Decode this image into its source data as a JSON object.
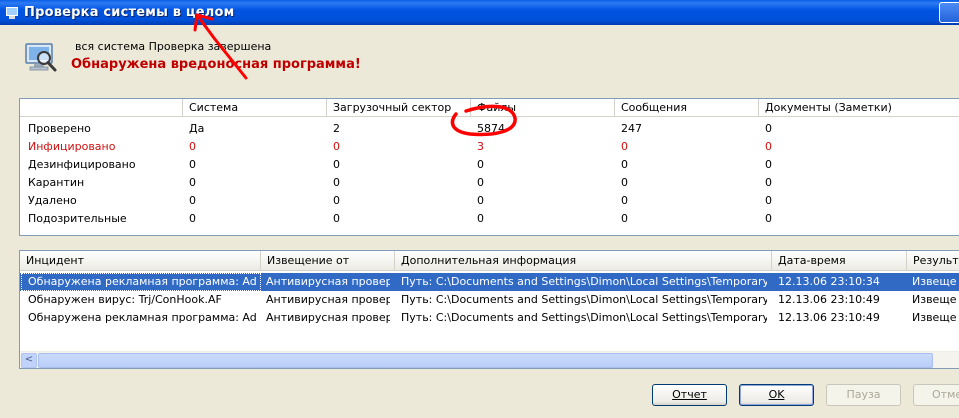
{
  "window": {
    "title": "Проверка системы в целом"
  },
  "header": {
    "status": "вся система Проверка завершена",
    "alert": "Обнаружена вредоносная программа!"
  },
  "stats": {
    "columns": [
      "",
      "Система",
      "Загрузочный сектор",
      "Файлы",
      "Сообщения",
      "Документы (Заметки)"
    ],
    "rows": [
      {
        "label": "Проверено",
        "values": [
          "Да",
          "2",
          "5874",
          "247",
          "0"
        ]
      },
      {
        "label": "Инфицировано",
        "values": [
          "0",
          "0",
          "3",
          "0",
          "0"
        ]
      },
      {
        "label": "Дезинфицировано",
        "values": [
          "0",
          "0",
          "0",
          "0",
          "0"
        ]
      },
      {
        "label": "Карантин",
        "values": [
          "0",
          "0",
          "0",
          "0",
          "0"
        ]
      },
      {
        "label": "Удалено",
        "values": [
          "0",
          "0",
          "0",
          "0",
          "0"
        ]
      },
      {
        "label": "Подозрительные",
        "values": [
          "0",
          "0",
          "0",
          "0",
          "0"
        ]
      }
    ]
  },
  "incidents": {
    "columns": [
      "Инцидент",
      "Извещение от",
      "Дополнительная информация",
      "Дата-время",
      "Результа"
    ],
    "rows": [
      {
        "incident": "Обнаружена рекламная программа: Adwa...",
        "from": "Антивирусная провер...",
        "info": "Путь: C:\\Documents and Settings\\Dimon\\Local Settings\\Temporary Inter...",
        "datetime": "12.13.06 23:10:34",
        "result": "Извеще"
      },
      {
        "incident": "Обнаружен вирус: Trj/ConHook.AF",
        "from": "Антивирусная провер...",
        "info": "Путь: C:\\Documents and Settings\\Dimon\\Local Settings\\Temporary Inter...",
        "datetime": "12.13.06 23:10:49",
        "result": "Извеще"
      },
      {
        "incident": "Обнаружена рекламная программа: Adwa...",
        "from": "Антивирусная провер...",
        "info": "Путь: C:\\Documents and Settings\\Dimon\\Local Settings\\Temporary Inter...",
        "datetime": "12.13.06 23:10:49",
        "result": "Извеще"
      }
    ]
  },
  "scrollbar": {
    "left_arrow": "<"
  },
  "buttons": {
    "report": "Отчет",
    "ok": "OK",
    "pause": "Пауза",
    "cancel": "Отме"
  },
  "colors": {
    "titlebar": "#0054E3",
    "alert": "#C00000",
    "selection": "#316AC5",
    "annotation": "#FF0000"
  }
}
